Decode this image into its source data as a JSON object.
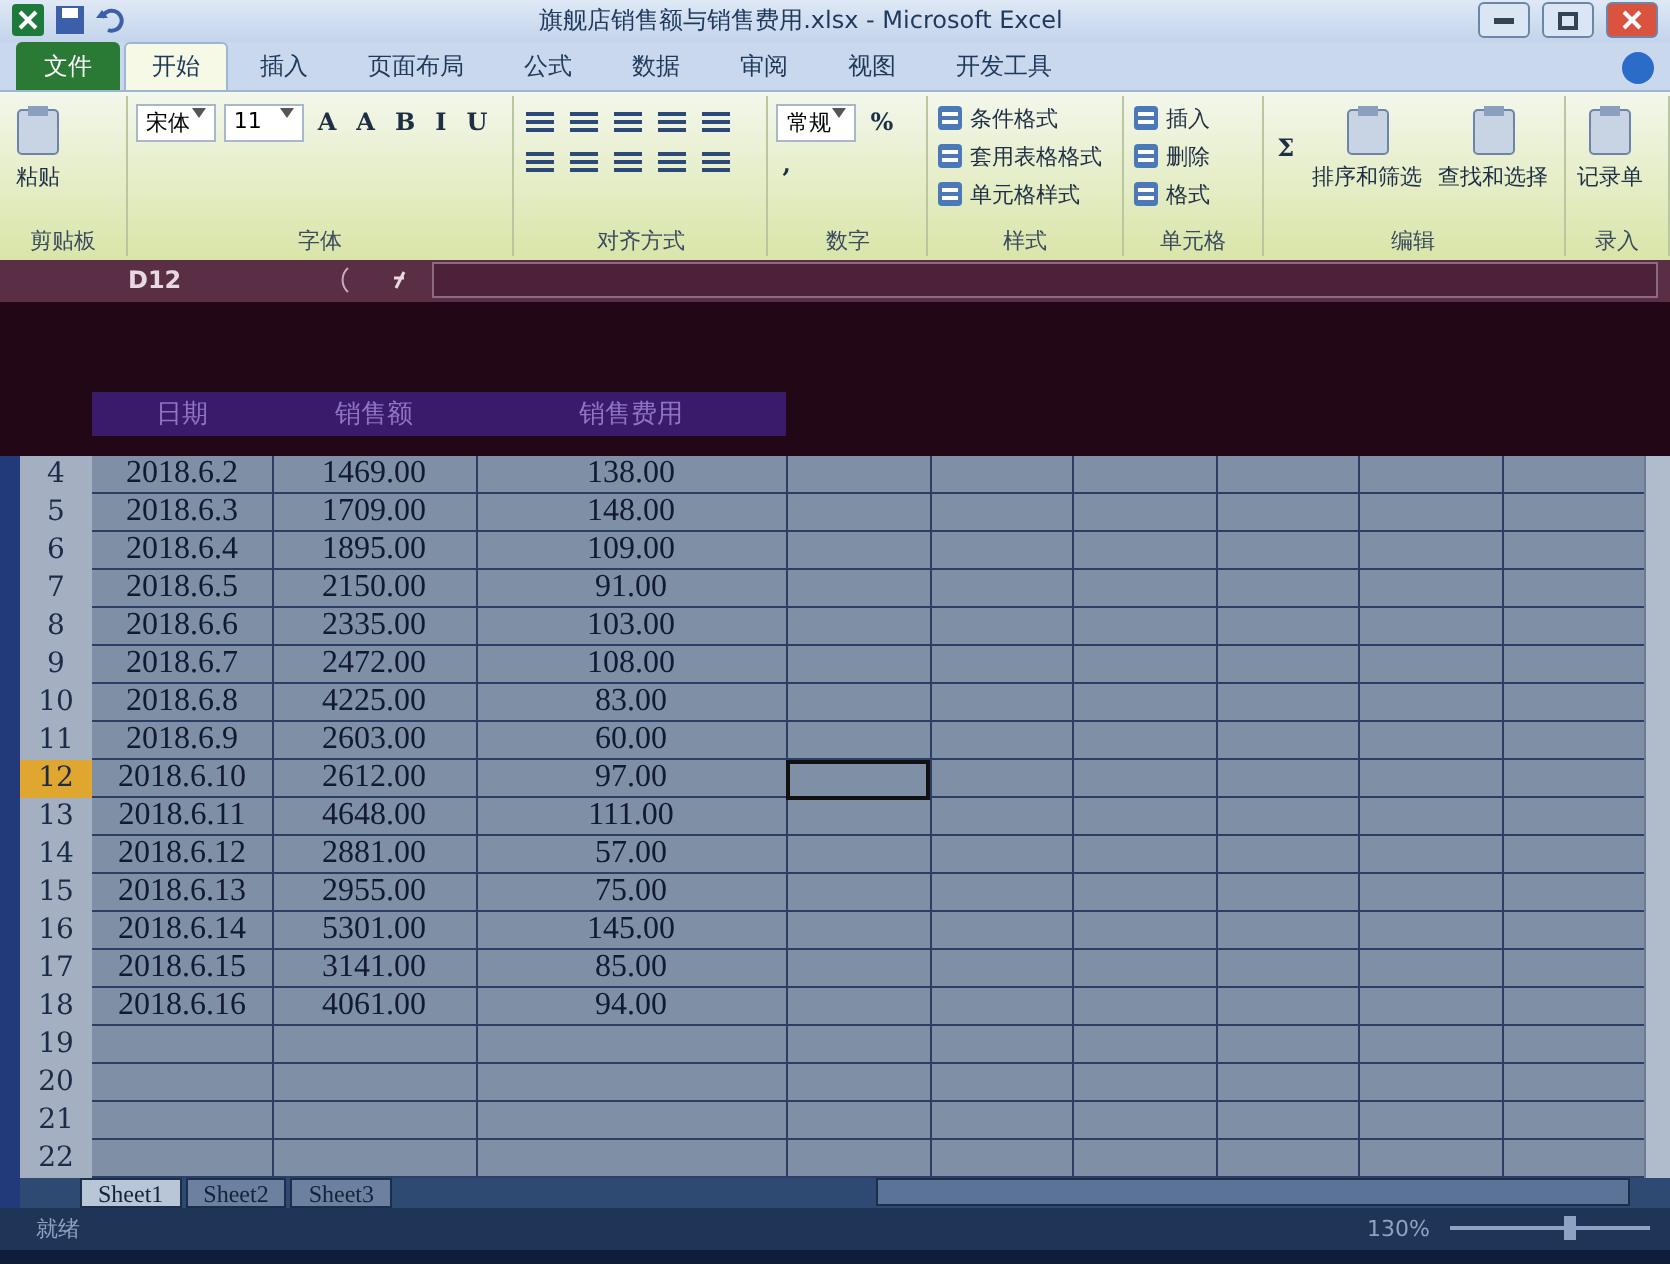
{
  "window": {
    "title": "旗舰店销售额与销售费用.xlsx - Microsoft Excel"
  },
  "tabs": [
    {
      "label": "文件",
      "kind": "file",
      "selected": false
    },
    {
      "label": "开始",
      "kind": "tab",
      "selected": true
    },
    {
      "label": "插入",
      "kind": "tab",
      "selected": false
    },
    {
      "label": "页面布局",
      "kind": "tab",
      "selected": false
    },
    {
      "label": "公式",
      "kind": "tab",
      "selected": false
    },
    {
      "label": "数据",
      "kind": "tab",
      "selected": false
    },
    {
      "label": "审阅",
      "kind": "tab",
      "selected": false
    },
    {
      "label": "视图",
      "kind": "tab",
      "selected": false
    },
    {
      "label": "开发工具",
      "kind": "tab",
      "selected": false
    }
  ],
  "ribbon": [
    {
      "label": "剪贴板",
      "items": [
        {
          "kind": "big",
          "text": "粘贴"
        }
      ]
    },
    {
      "label": "字体",
      "items": [
        {
          "kind": "field",
          "text": "宋体"
        },
        {
          "kind": "field",
          "text": "11"
        },
        {
          "kind": "glyph",
          "text": "A"
        },
        {
          "kind": "glyph",
          "text": "A"
        },
        {
          "kind": "glyph",
          "text": "B"
        },
        {
          "kind": "glyph",
          "text": "I"
        },
        {
          "kind": "glyph",
          "text": "U"
        }
      ]
    },
    {
      "label": "对齐方式",
      "items": [
        {
          "kind": "align"
        }
      ]
    },
    {
      "label": "数字",
      "items": [
        {
          "kind": "field",
          "text": "常规"
        },
        {
          "kind": "glyph",
          "text": "%"
        },
        {
          "kind": "glyph",
          "text": ","
        }
      ]
    },
    {
      "label": "样式",
      "items": [
        {
          "kind": "small",
          "text": "条件格式"
        },
        {
          "kind": "small",
          "text": "套用表格格式"
        },
        {
          "kind": "small",
          "text": "单元格样式"
        }
      ]
    },
    {
      "label": "单元格",
      "items": [
        {
          "kind": "small",
          "text": "插入"
        },
        {
          "kind": "small",
          "text": "删除"
        },
        {
          "kind": "small",
          "text": "格式"
        }
      ]
    },
    {
      "label": "编辑",
      "items": [
        {
          "kind": "glyph",
          "text": "Σ"
        },
        {
          "kind": "big",
          "text": "排序和筛选"
        },
        {
          "kind": "big",
          "text": "查找和选择"
        }
      ]
    },
    {
      "label": "录入",
      "items": [
        {
          "kind": "big",
          "text": "记录单"
        }
      ]
    }
  ],
  "name_box": "D12",
  "header_row": [
    "日期",
    "销售额",
    "销售费用"
  ],
  "rows": [
    {
      "row_header": "4",
      "cells": [
        "2018.6.2",
        "1469.00",
        "138.00"
      ],
      "selected": false
    },
    {
      "row_header": "5",
      "cells": [
        "2018.6.3",
        "1709.00",
        "148.00"
      ],
      "selected": false
    },
    {
      "row_header": "6",
      "cells": [
        "2018.6.4",
        "1895.00",
        "109.00"
      ],
      "selected": false
    },
    {
      "row_header": "7",
      "cells": [
        "2018.6.5",
        "2150.00",
        "91.00"
      ],
      "selected": false
    },
    {
      "row_header": "8",
      "cells": [
        "2018.6.6",
        "2335.00",
        "103.00"
      ],
      "selected": false
    },
    {
      "row_header": "9",
      "cells": [
        "2018.6.7",
        "2472.00",
        "108.00"
      ],
      "selected": false
    },
    {
      "row_header": "10",
      "cells": [
        "2018.6.8",
        "4225.00",
        "83.00"
      ],
      "selected": false
    },
    {
      "row_header": "11",
      "cells": [
        "2018.6.9",
        "2603.00",
        "60.00"
      ],
      "selected": false
    },
    {
      "row_header": "12",
      "cells": [
        "2018.6.10",
        "2612.00",
        "97.00"
      ],
      "selected": true
    },
    {
      "row_header": "13",
      "cells": [
        "2018.6.11",
        "4648.00",
        "111.00"
      ],
      "selected": false
    },
    {
      "row_header": "14",
      "cells": [
        "2018.6.12",
        "2881.00",
        "57.00"
      ],
      "selected": false
    },
    {
      "row_header": "15",
      "cells": [
        "2018.6.13",
        "2955.00",
        "75.00"
      ],
      "selected": false
    },
    {
      "row_header": "16",
      "cells": [
        "2018.6.14",
        "5301.00",
        "145.00"
      ],
      "selected": false
    },
    {
      "row_header": "17",
      "cells": [
        "2018.6.15",
        "3141.00",
        "85.00"
      ],
      "selected": false
    },
    {
      "row_header": "18",
      "cells": [
        "2018.6.16",
        "4061.00",
        "94.00"
      ],
      "selected": false
    },
    {
      "row_header": "19",
      "cells": [],
      "selected": false
    },
    {
      "row_header": "20",
      "cells": [],
      "selected": false
    },
    {
      "row_header": "21",
      "cells": [],
      "selected": false
    },
    {
      "row_header": "22",
      "cells": [],
      "selected": false
    }
  ],
  "sheet_tabs": [
    {
      "label": "Sheet1",
      "selected": true
    },
    {
      "label": "Sheet2",
      "selected": false
    },
    {
      "label": "Sheet3",
      "selected": false
    }
  ],
  "status_bar": {
    "status": "就绪",
    "zoom": "130%",
    "level": 0.6
  }
}
